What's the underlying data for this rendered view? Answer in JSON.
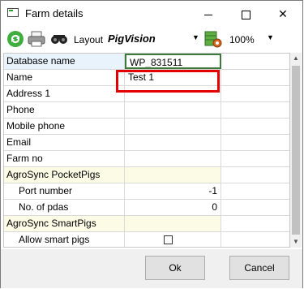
{
  "window": {
    "title": "Farm details"
  },
  "toolbar": {
    "layout_label": "Layout",
    "layout_value": "PigVision",
    "zoom_value": "100%",
    "icons": [
      "refresh-icon",
      "print-icon",
      "layout-icon",
      "grid-settings-icon"
    ]
  },
  "grid": {
    "rows": [
      {
        "label": "Database name",
        "value": "WP_831511"
      },
      {
        "label": "Name",
        "value": "Test 1"
      },
      {
        "label": "Address 1",
        "value": ""
      },
      {
        "label": "Phone",
        "value": ""
      },
      {
        "label": "Mobile phone",
        "value": ""
      },
      {
        "label": "Email",
        "value": ""
      },
      {
        "label": "Farm no",
        "value": ""
      },
      {
        "label": "AgroSync PocketPigs",
        "value": ""
      },
      {
        "label": "Port number",
        "value": "-1"
      },
      {
        "label": "No. of pdas",
        "value": "0"
      },
      {
        "label": "AgroSync SmartPigs",
        "value": ""
      },
      {
        "label": "Allow smart pigs",
        "value": ""
      }
    ],
    "allow_smart_pigs_checked": false
  },
  "buttons": {
    "ok": "Ok",
    "cancel": "Cancel"
  },
  "colors": {
    "selected_border": "#3b7a3b",
    "highlight": "#e50000",
    "category_bg": "#fbfbe6"
  }
}
